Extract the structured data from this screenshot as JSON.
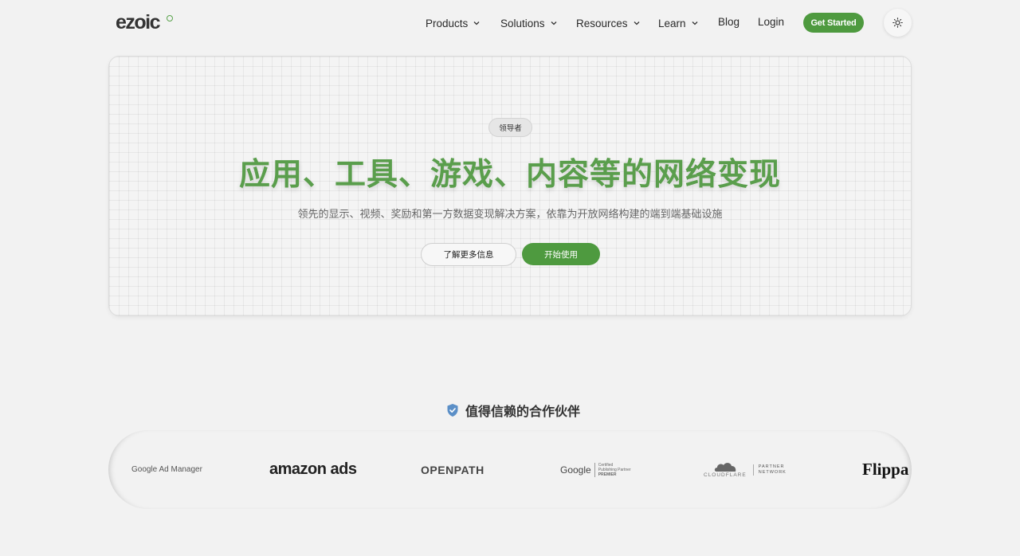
{
  "nav": {
    "logo": "ezoic",
    "items": [
      {
        "label": "Products"
      },
      {
        "label": "Solutions"
      },
      {
        "label": "Resources"
      },
      {
        "label": "Learn"
      }
    ],
    "blog": "Blog",
    "login": "Login",
    "cta": "Get Started",
    "theme_icon": "sun-icon"
  },
  "hero": {
    "badge": "领导者",
    "title": "应用、工具、游戏、内容等的网络变现",
    "subtitle": "领先的显示、视频、奖励和第一方数据变现解决方案，依靠为开放网络构建的端到端基础设施",
    "learn_more": "了解更多信息",
    "start": "开始使用"
  },
  "partners": {
    "heading": "值得信赖的合作伙伴",
    "logos": {
      "google_ad_manager": "Google Ad Manager",
      "amazon_ads": "amazon ads",
      "openpath": "OPENPATH",
      "google": "Google",
      "google_badge_line1": "Certified",
      "google_badge_line2": "Publishing Partner",
      "google_badge_line3": "PREMIER",
      "cloudflare": "CLOUDFLARE",
      "cloudflare_badge_line1": "PARTNER",
      "cloudflare_badge_line2": "NETWORK",
      "flippa": "Flippa"
    }
  },
  "colors": {
    "accent": "#4e9a3f",
    "title": "#5a9e4c",
    "background": "#f2f2f2"
  }
}
